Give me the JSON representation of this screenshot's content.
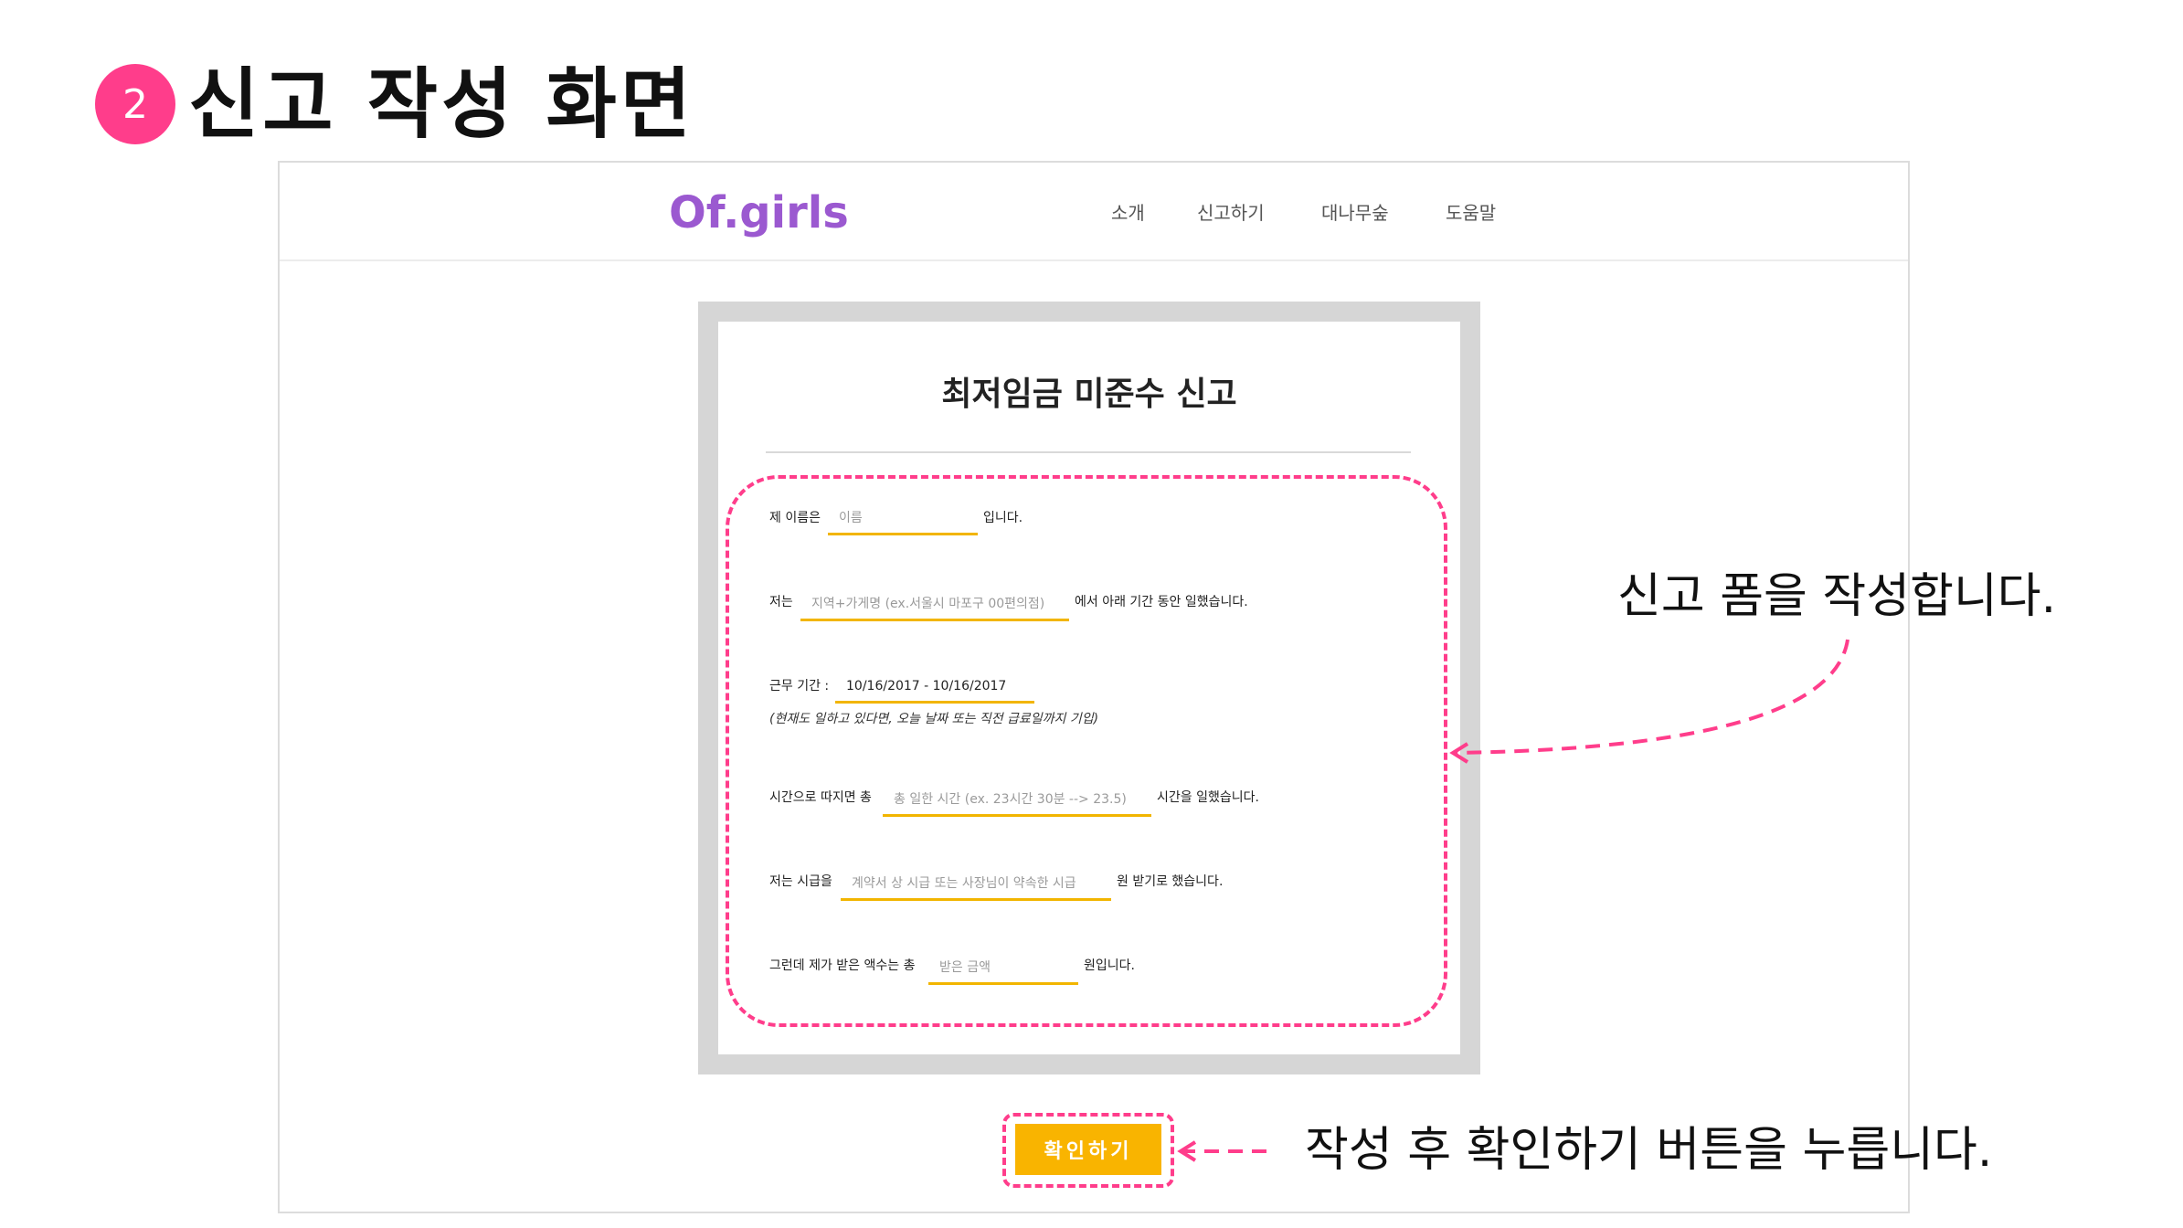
{
  "slide": {
    "step_number": "2",
    "title": "신고 작성 화면"
  },
  "site": {
    "logo": "Of.girls",
    "nav": [
      "소개",
      "신고하기",
      "대나무숲",
      "도움말"
    ]
  },
  "form": {
    "title": "최저임금 미준수 신고",
    "rows": [
      {
        "prefix": "제 이름은",
        "placeholder": "이름",
        "suffix": "입니다."
      },
      {
        "prefix": "저는",
        "placeholder": "지역+가게명 (ex.서울시 마포구 00편의점)",
        "suffix": "에서 아래 기간 동안 일했습니다."
      },
      {
        "prefix": "근무 기간 :",
        "value": "10/16/2017 - 10/16/2017",
        "note": "(현재도 일하고 있다면, 오늘 날짜 또는 직전 급료일까지 기입)"
      },
      {
        "prefix": "시간으로 따지면 총",
        "placeholder": "총 일한 시간 (ex. 23시간 30분 --> 23.5)",
        "suffix": "시간을 일했습니다."
      },
      {
        "prefix": "저는 시급을",
        "placeholder": "계약서 상 시급 또는 사장님이 약속한 시급",
        "suffix": "원 받기로 했습니다."
      },
      {
        "prefix": "그런데 제가 받은 액수는 총",
        "placeholder": "받은 금액",
        "suffix": "원입니다."
      }
    ],
    "submit_label": "확인하기"
  },
  "callouts": {
    "form_note": "신고 폼을 작성합니다.",
    "button_note": "작성 후 확인하기 버튼을 누릅니다."
  },
  "colors": {
    "accent_pink": "#ff3d8b",
    "logo_purple": "#9b59d0",
    "button_yellow": "#f9b400"
  }
}
